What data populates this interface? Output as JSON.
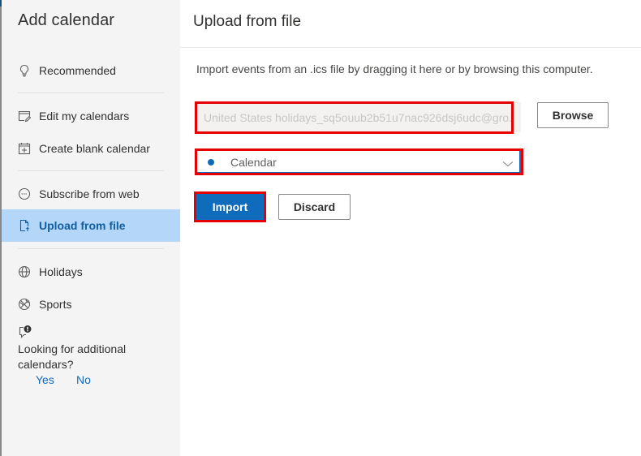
{
  "sidebar": {
    "title": "Add calendar",
    "items": [
      {
        "label": "Recommended",
        "icon": "lightbulb-icon"
      },
      {
        "label": "Edit my calendars",
        "icon": "edit-calendar-icon"
      },
      {
        "label": "Create blank calendar",
        "icon": "add-calendar-icon"
      },
      {
        "label": "Subscribe from web",
        "icon": "link-circle-icon"
      },
      {
        "label": "Upload from file",
        "icon": "file-upload-icon",
        "selected": true
      },
      {
        "label": "Holidays",
        "icon": "globe-icon"
      },
      {
        "label": "Sports",
        "icon": "sports-ball-icon"
      }
    ],
    "feedback": {
      "icon": "feedback-alert-icon",
      "text": "Looking for additional calendars?",
      "yes": "Yes",
      "no": "No"
    }
  },
  "main": {
    "title": "Upload from file",
    "intro": "Import events from an .ics file by dragging it here or by browsing this computer.",
    "file_input": {
      "value": "United States holidays_sq5ouub2b51u7nac926dsj6udc@gro..."
    },
    "browse_label": "Browse",
    "calendar_select": {
      "selected": "Calendar",
      "dot_color": "#0f6cbd"
    },
    "import_label": "Import",
    "discard_label": "Discard"
  },
  "colors": {
    "accent": "#0f6cbd",
    "selected_bg": "#b3d6f9",
    "highlight_outline": "#e60000"
  }
}
